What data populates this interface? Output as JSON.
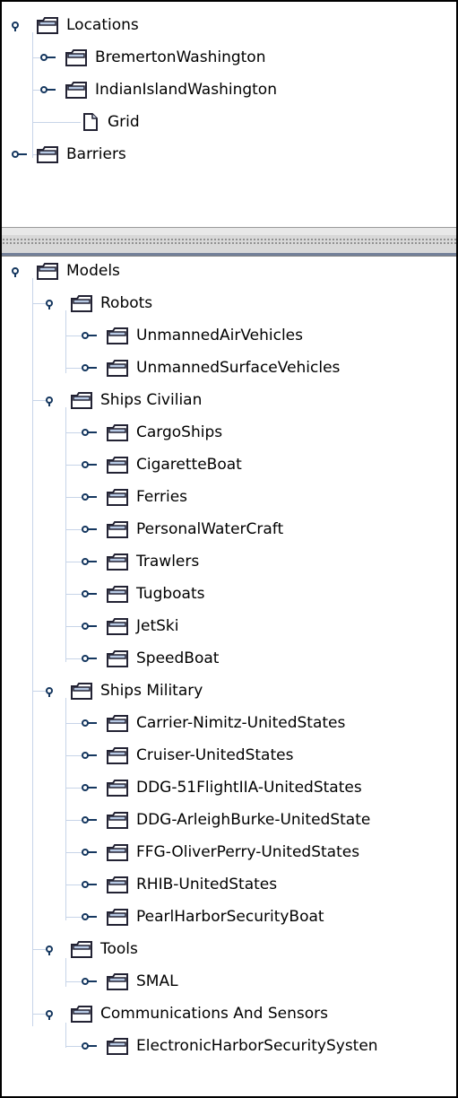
{
  "top": {
    "locations": "Locations",
    "bremerton": "BremertonWashington",
    "indianisland": "IndianIslandWashington",
    "grid": "Grid",
    "barriers": "Barriers"
  },
  "bottom": {
    "models": "Models",
    "robots": "Robots",
    "uav": "UnmannedAirVehicles",
    "usv": "UnmannedSurfaceVehicles",
    "ships_civilian": "Ships Civilian",
    "cargoships": "CargoShips",
    "cigaretteboat": "CigaretteBoat",
    "ferries": "Ferries",
    "personalwatercraft": "PersonalWaterCraft",
    "trawlers": "Trawlers",
    "tugboats": "Tugboats",
    "jetski": "JetSki",
    "speedboat": "SpeedBoat",
    "ships_military": "Ships Military",
    "carrier": "Carrier-Nimitz-UnitedStates",
    "cruiser": "Cruiser-UnitedStates",
    "ddg51": "DDG-51FlightIIA-UnitedStates",
    "ddgab": "DDG-ArleighBurke-UnitedState",
    "ffg": "FFG-OliverPerry-UnitedStates",
    "rhib": "RHIB-UnitedStates",
    "pearl": "PearlHarborSecurityBoat",
    "tools": "Tools",
    "smal": "SMAL",
    "comms": "Communications And Sensors",
    "ehss": "ElectronicHarborSecuritySysten"
  }
}
